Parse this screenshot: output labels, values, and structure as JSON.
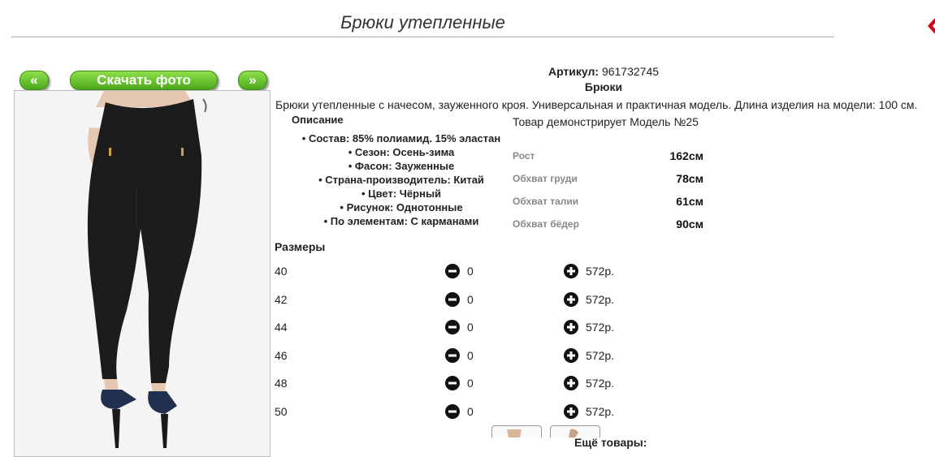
{
  "page": {
    "title": "Брюки утепленные"
  },
  "nav": {
    "prev_label": "«",
    "next_label": "»",
    "download_label": "Скачать фото"
  },
  "product": {
    "article_label": "Артикул:",
    "article_value": "961732745",
    "type": "Брюки",
    "description": "Брюки утепленные с начесом, зауженного кроя. Универсальная и практичная модель. Длина изделия на модели: 100 см."
  },
  "description_section": {
    "heading": "Описание",
    "items": [
      "Состав: 85% полиамид. 15% эластан",
      "Сезон: Осень-зима",
      "Фасон: Зауженные",
      "Страна-производитель: Китай",
      "Цвет: Чёрный",
      "Рисунок: Однотонные",
      "По элементам: С карманами"
    ]
  },
  "model": {
    "heading": "Товар демонстрирует Модель №25",
    "measurements": [
      {
        "label": "Рост",
        "value": "162см"
      },
      {
        "label": "Обхват груди",
        "value": "78см"
      },
      {
        "label": "Обхват талии",
        "value": "61см"
      },
      {
        "label": "Обхват бёдер",
        "value": "90см"
      }
    ]
  },
  "sizes": {
    "heading": "Размеры",
    "rows": [
      {
        "size": "40",
        "qty": "0",
        "price": "572р."
      },
      {
        "size": "42",
        "qty": "0",
        "price": "572р."
      },
      {
        "size": "44",
        "qty": "0",
        "price": "572р."
      },
      {
        "size": "46",
        "qty": "0",
        "price": "572р."
      },
      {
        "size": "48",
        "qty": "0",
        "price": "572р."
      },
      {
        "size": "50",
        "qty": "0",
        "price": "572р."
      }
    ]
  },
  "more": {
    "label": "Ещё товары:"
  },
  "colors": {
    "button_green": "#4aa81c",
    "close_red": "#d0021b"
  }
}
